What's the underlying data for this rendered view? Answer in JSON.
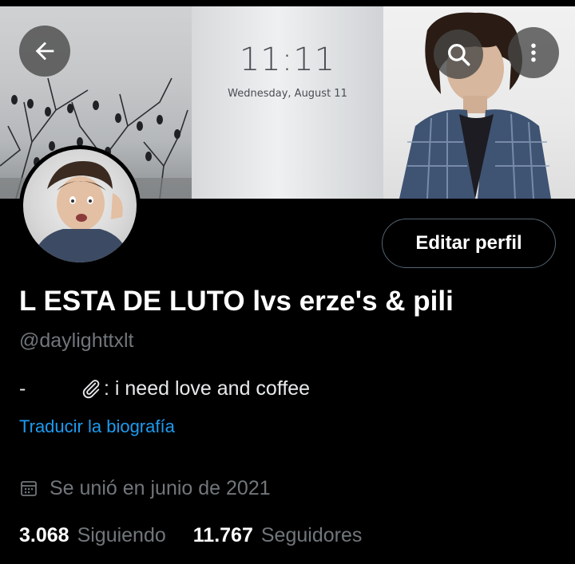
{
  "banner": {
    "lock_time": "11:11",
    "lock_date": "Wednesday, August 11"
  },
  "header": {
    "back_icon": "arrow-left-icon",
    "search_icon": "search-icon",
    "more_icon": "more-vertical-icon"
  },
  "profile": {
    "edit_label": "Editar perfil",
    "display_name": "L ESTA DE LUTO lvs erze's & pili",
    "handle": "@daylighttxlt",
    "bio_dash": "-",
    "bio_text": ": i need love and coffee",
    "translate_label": "Traducir la biografía",
    "joined": "Se unió en junio de 2021",
    "following_count": "3.068",
    "following_label": "Siguiendo",
    "followers_count": "11.767",
    "followers_label": "Seguidores"
  },
  "colors": {
    "background": "#000000",
    "accent": "#1d9bf0",
    "secondary_text": "#71767b"
  }
}
